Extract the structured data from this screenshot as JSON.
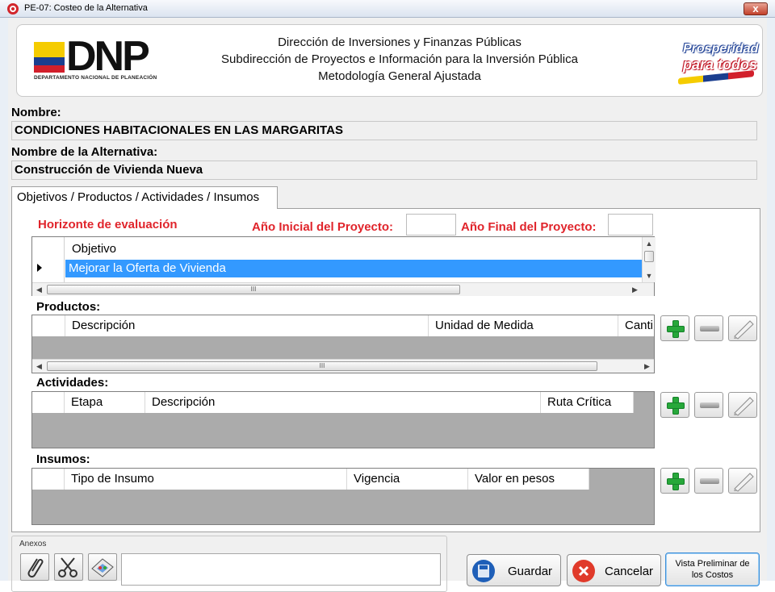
{
  "window": {
    "title": "PE-07: Costeo de la Alternativa",
    "close_label": "x"
  },
  "header": {
    "logo_text": "DNP",
    "logo_subtitle": "DEPARTAMENTO NACIONAL DE PLANEACIÓN",
    "line1": "Dirección de Inversiones y Finanzas Públicas",
    "line2": "Subdirección de Proyectos e Información para la Inversión Pública",
    "line3": "Metodología General Ajustada",
    "badge_line1": "Prosperidad",
    "badge_line2": "para todos"
  },
  "form": {
    "nombre_label": "Nombre:",
    "nombre_value": "CONDICIONES HABITACIONALES EN LAS MARGARITAS",
    "alternativa_label": "Nombre de la Alternativa:",
    "alternativa_value": "Construcción de Vivienda Nueva"
  },
  "tab": {
    "label": "Objetivos / Productos / Actividades / Insumos"
  },
  "horizonte": {
    "title": "Horizonte de evaluación",
    "anio_inicial_label": "Año Inicial del Proyecto:",
    "anio_inicial_value": "",
    "anio_final_label": "Año Final del Proyecto:",
    "anio_final_value": ""
  },
  "objetivos": {
    "columns": [
      "Objetivo"
    ],
    "rows": [
      "Mejorar la Oferta de Vivienda"
    ],
    "scroll_thumb": "III"
  },
  "productos": {
    "label": "Productos:",
    "columns": [
      "Descripción",
      "Unidad de Medida",
      "Canti"
    ],
    "scroll_thumb": "III"
  },
  "actividades": {
    "label": "Actividades:",
    "columns": [
      "Etapa",
      "Descripción",
      "Ruta Crítica"
    ]
  },
  "insumos": {
    "label": "Insumos:",
    "columns": [
      "Tipo de Insumo",
      "Vigencia",
      "Valor en pesos"
    ]
  },
  "icons": {
    "add": "plus-icon",
    "remove": "minus-icon",
    "edit": "edit-icon",
    "attach": "paperclip-icon",
    "cut": "scissors-icon",
    "picture": "image-icon",
    "save": "disk-icon",
    "cancel": "cancel-x-icon"
  },
  "colors": {
    "accent_red": "#e0242b",
    "selection_blue": "#3399ff",
    "grid_gray": "#ababab",
    "add_green": "#27a83a"
  },
  "footer": {
    "anexos_label": "Anexos",
    "guardar_label": "Guardar",
    "cancelar_label": "Cancelar",
    "preview_line1": "Vista Preliminar de",
    "preview_line2": "los Costos"
  }
}
